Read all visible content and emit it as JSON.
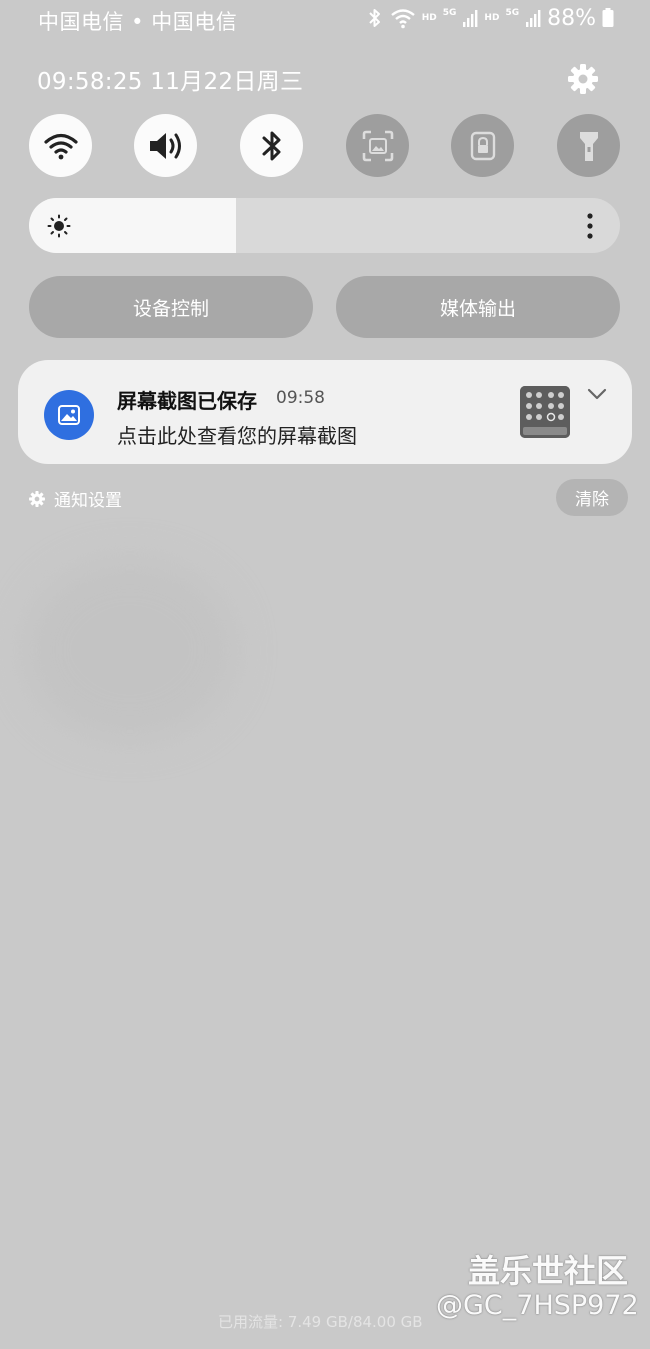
{
  "status_bar": {
    "carrier": "中国电信 • 中国电信",
    "icons": [
      "bluetooth-icon",
      "wifi-icon",
      "signal-icon",
      "signal-icon",
      "battery-icon"
    ],
    "hd1": "HD",
    "g1": "5G",
    "hd2": "HD",
    "g2": "5G",
    "battery": "88%"
  },
  "header": {
    "datetime": "09:58:25  11月22日周三",
    "settings_icon": "gear-icon"
  },
  "quick_tiles": [
    {
      "name": "wifi",
      "icon": "wifi-icon",
      "state": "on"
    },
    {
      "name": "sound",
      "icon": "speaker-icon",
      "state": "on"
    },
    {
      "name": "bluetooth",
      "icon": "bluetooth-icon",
      "state": "on"
    },
    {
      "name": "screenshot-capture",
      "icon": "screen-capture-icon",
      "state": "off"
    },
    {
      "name": "rotation-lock",
      "icon": "lock-icon",
      "state": "off"
    },
    {
      "name": "flashlight",
      "icon": "flashlight-icon",
      "state": "off"
    }
  ],
  "brightness": {
    "level": 0.35,
    "icon": "sun-icon",
    "more_icon": "more-vertical-icon"
  },
  "buttons": {
    "device_control": "设备控制",
    "media_output": "媒体输出"
  },
  "notification": {
    "title": "屏幕截图已保存",
    "time": "09:58",
    "body": "点击此处查看您的屏幕截图",
    "app_icon": "gallery-icon",
    "expand_icon": "chevron-down-icon"
  },
  "footer": {
    "notification_settings": "通知设置",
    "clear": "清除",
    "data_usage": "已用流量: 7.49 GB/84.00 GB"
  },
  "watermark": {
    "line1": "盖乐世社区",
    "line2": "@GC_7HSP972"
  },
  "colors": {
    "shade_background": "#c9c9c9",
    "tile_on": "#fbfbfb",
    "tile_off": "#9e9e9e",
    "accent_blue": "#2f6fe0"
  }
}
